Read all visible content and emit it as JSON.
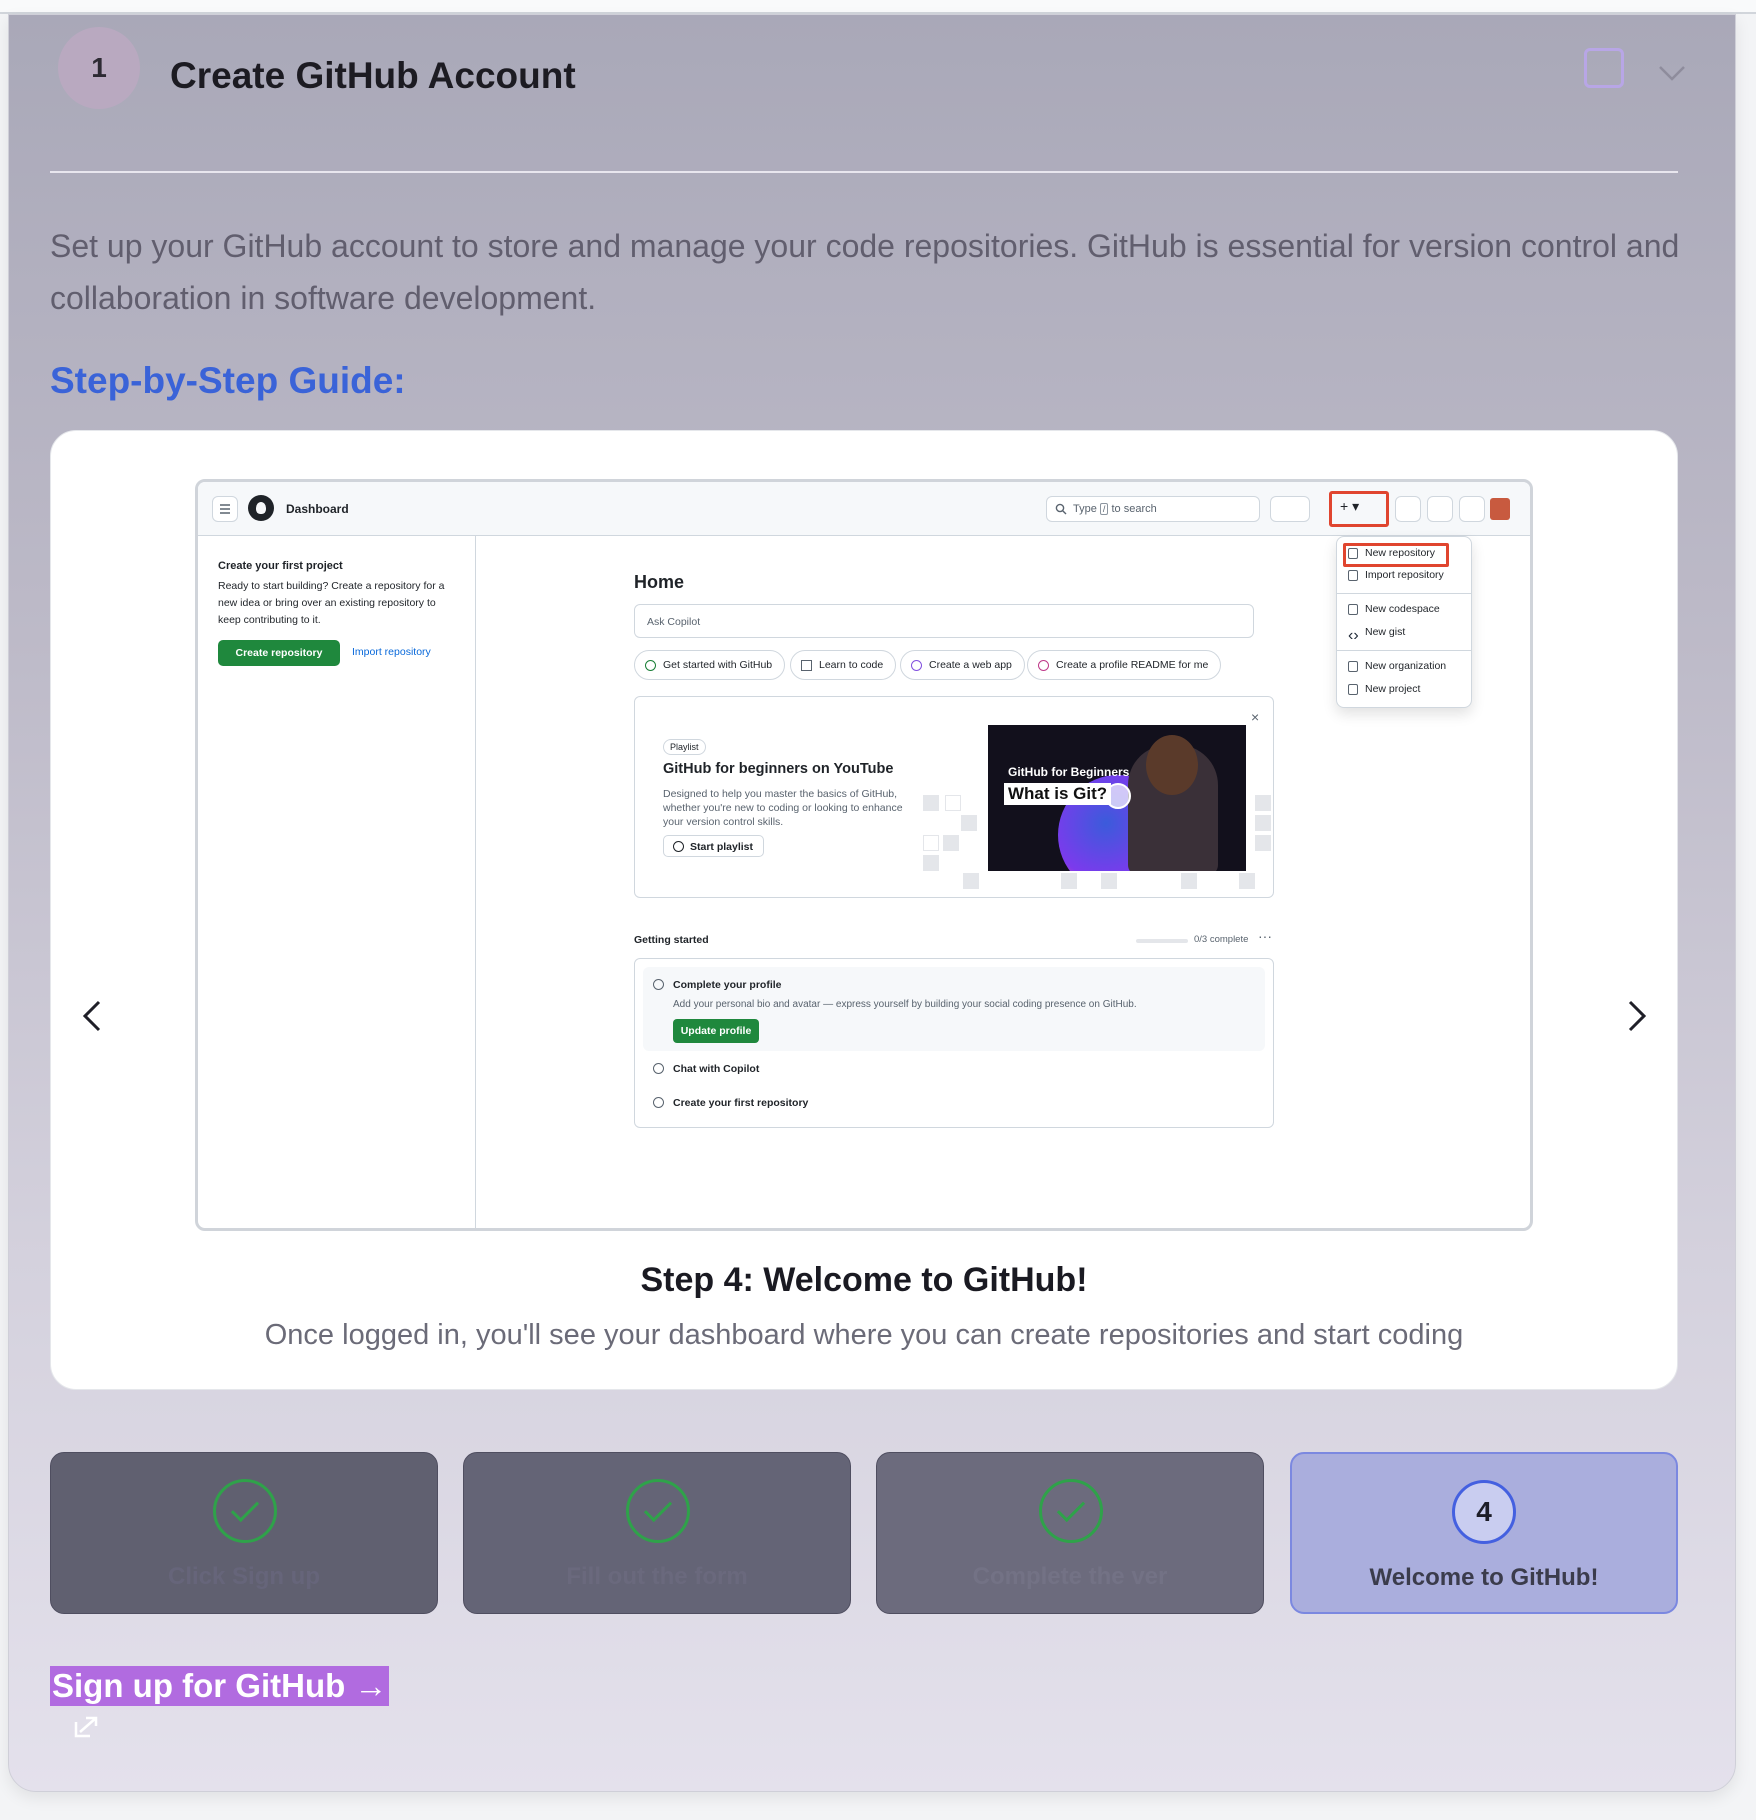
{
  "step": {
    "number": "1",
    "title": "Create GitHub Account",
    "description": "Set up your GitHub account to store and manage your code repositories. GitHub is essential for version control and collaboration in software development.",
    "guide_heading": "Step-by-Step Guide:"
  },
  "slide": {
    "title": "Step 4: Welcome to GitHub!",
    "description": "Once logged in, you'll see your dashboard where you can create repositories and start coding"
  },
  "screenshot": {
    "header": {
      "title": "Dashboard",
      "search_prefix": "Type",
      "search_key": "/",
      "search_suffix": "to search",
      "plus": "+ ▾"
    },
    "sidebar": {
      "heading": "Create your first project",
      "text": "Ready to start building? Create a repository for a new idea or bring over an existing repository to keep contributing to it.",
      "create_button": "Create repository",
      "import_link": "Import repository"
    },
    "home": {
      "title": "Home",
      "ask_placeholder": "Ask Copilot",
      "chips": [
        "Get started with GitHub",
        "Learn to code",
        "Create a web app",
        "Create a profile README for me"
      ]
    },
    "menu": {
      "items": [
        "New repository",
        "Import repository",
        "New codespace",
        "New gist",
        "New organization",
        "New project"
      ]
    },
    "playlist": {
      "badge": "Playlist",
      "title": "GitHub for beginners on YouTube",
      "description": "Designed to help you master the basics of GitHub, whether you're new to coding or looking to enhance your version control skills.",
      "button": "Start playlist",
      "close": "×",
      "video_brand": "GitHub for Beginners",
      "video_title": "What is Git?"
    },
    "getting_started": {
      "title": "Getting started",
      "progress": "0/3 complete",
      "progress_fraction": 0,
      "more": "···",
      "items": [
        {
          "title": "Complete your profile",
          "description": "Add your personal bio and avatar — express yourself by building your social coding presence on GitHub.",
          "button": "Update profile"
        },
        {
          "title": "Chat with Copilot"
        },
        {
          "title": "Create your first repository"
        }
      ]
    }
  },
  "steps": [
    {
      "label": "Click Sign up",
      "state": "done"
    },
    {
      "label": "Fill out the form",
      "state": "done"
    },
    {
      "label": "Complete the ver",
      "state": "done"
    },
    {
      "label": "Welcome to GitHub!",
      "number": "4",
      "state": "current"
    }
  ],
  "cta": {
    "label": "Sign up for GitHub →"
  },
  "colors": {
    "accent_blue": "#3a63d8",
    "done_green": "#2fa24a",
    "cta_purple": "#b16be0",
    "gh_green": "#1f883d",
    "highlight_red": "#e0452f"
  },
  "icons": {
    "collapse": "chevron-down-icon",
    "prev": "chevron-left-icon",
    "next": "chevron-right-icon",
    "external": "external-link-icon",
    "done": "check-icon"
  }
}
